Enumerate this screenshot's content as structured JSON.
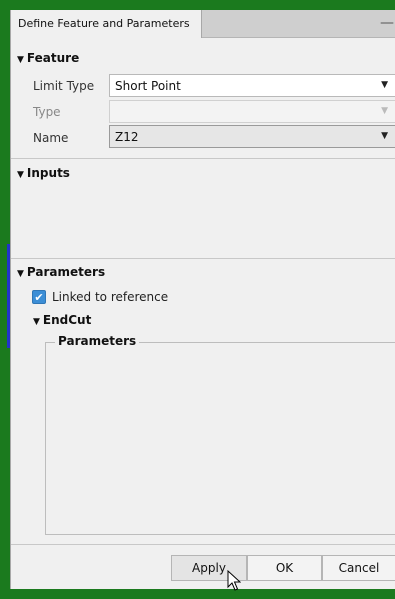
{
  "window": {
    "tab_title": "Define Feature and Parameters",
    "minimize_glyph": "—"
  },
  "feature": {
    "title": "Feature",
    "fields": [
      {
        "label": "Limit Type",
        "value": "Short Point",
        "enabled": true
      },
      {
        "label": "Type",
        "value": "",
        "enabled": false
      },
      {
        "label": "Name",
        "value": "Z12",
        "enabled": true
      }
    ]
  },
  "inputs": {
    "title": "Inputs"
  },
  "parameters": {
    "title": "Parameters",
    "linked_checkbox": {
      "label": "Linked to reference",
      "checked": true
    },
    "endcut": {
      "title": "EndCut",
      "group_title": "Parameters"
    }
  },
  "footer": {
    "apply_label": "Apply",
    "ok_label": "OK",
    "cancel_label": "Cancel"
  },
  "icons": {
    "collapse": "triangle-down-icon",
    "dropdown": "chevron-down-icon",
    "check": "checkmark-icon",
    "cursor": "mouse-pointer-icon"
  },
  "colors": {
    "desktop": "#1b7a1e",
    "checkbox": "#3c8ed6",
    "panel": "#f0f0f0"
  }
}
